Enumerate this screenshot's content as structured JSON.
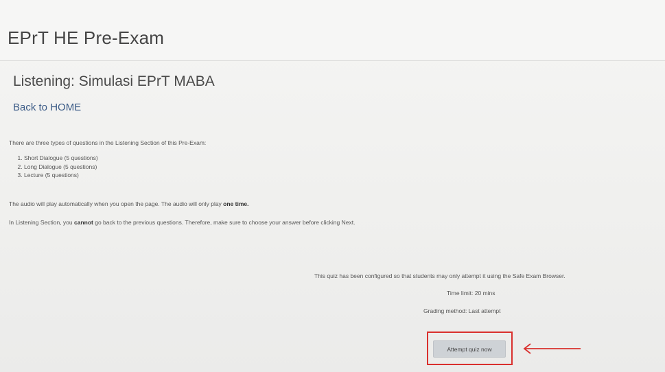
{
  "header": {
    "site_title": "EPrT HE Pre-Exam"
  },
  "quiz": {
    "title": "Listening: Simulasi EPrT MABA",
    "back_link": "Back to HOME",
    "intro": "There are three types of questions in the Listening Section of this Pre-Exam:",
    "question_types": [
      "Short Dialogue (5 questions)",
      "Long Dialogue (5 questions)",
      "Lecture (5 questions)"
    ],
    "audio_note_prefix": "The audio will play automatically when you open the page. The audio will only play ",
    "audio_note_bold": "one time.",
    "back_note_prefix": "In Listening Section, you ",
    "back_note_bold": "cannot",
    "back_note_suffix": " go back to the previous questions. Therefore, make sure to choose your answer before clicking Next."
  },
  "info": {
    "seb_note": "This quiz has been configured so that students may only attempt it using the Safe Exam Browser.",
    "time_limit": "Time limit: 20 mins",
    "grading_method": "Grading method: Last attempt"
  },
  "actions": {
    "attempt_label": "Attempt quiz now"
  },
  "annotation": {
    "color": "#d9302d",
    "arrow_icon": "left-arrow-icon"
  }
}
